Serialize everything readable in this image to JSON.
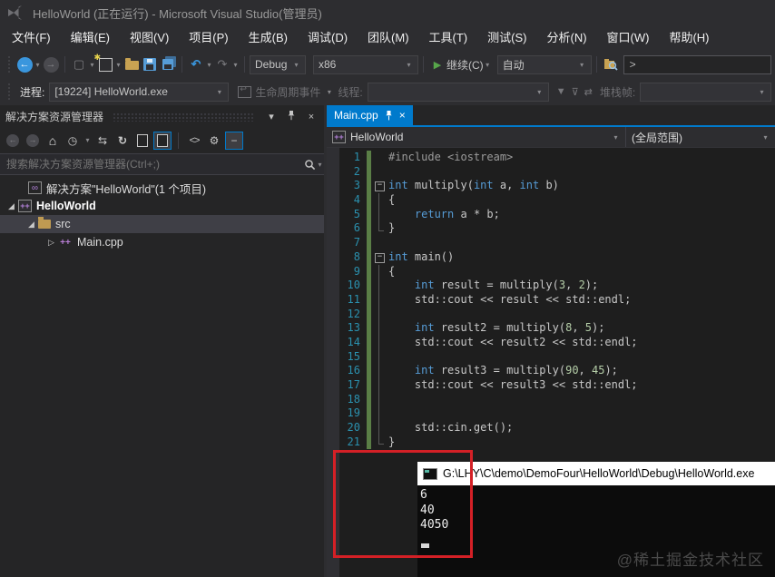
{
  "window": {
    "title": "HelloWorld (正在运行) - Microsoft Visual Studio(管理员)"
  },
  "menu": {
    "items": [
      "文件(F)",
      "编辑(E)",
      "视图(V)",
      "项目(P)",
      "生成(B)",
      "调试(D)",
      "团队(M)",
      "工具(T)",
      "测试(S)",
      "分析(N)",
      "窗口(W)",
      "帮助(H)"
    ]
  },
  "toolbar": {
    "debug_config": "Debug",
    "platform": "x86",
    "continue_label": "继续(C)",
    "auto_label": "自动",
    "prompt": ">"
  },
  "debug_bar": {
    "process_label": "进程:",
    "process_value": "[19224] HelloWorld.exe",
    "lifecycle_label": "生命周期事件",
    "thread_label": "线程:",
    "stack_label": "堆栈帧:"
  },
  "solution_explorer": {
    "title": "解决方案资源管理器",
    "search_placeholder": "搜索解决方案资源管理器(Ctrl+;)",
    "tree": [
      {
        "id": "solution",
        "label": "解决方案\"HelloWorld\"(1 个项目)",
        "icon": "solution",
        "arrow": "none",
        "indent": 16,
        "selected": false,
        "bold": false
      },
      {
        "id": "helloworld",
        "label": "HelloWorld",
        "icon": "project",
        "arrow": "expanded",
        "indent": 5,
        "selected": false,
        "bold": true
      },
      {
        "id": "src",
        "label": "src",
        "icon": "folder",
        "arrow": "expanded",
        "indent": 27,
        "selected": true,
        "bold": false
      },
      {
        "id": "main-cpp",
        "label": "Main.cpp",
        "icon": "cpp",
        "arrow": "collapsed",
        "indent": 49,
        "selected": false,
        "bold": false
      }
    ]
  },
  "editor": {
    "tab": {
      "label": "Main.cpp"
    },
    "nav_left": "HelloWorld",
    "nav_right": "(全局范围)",
    "code": {
      "lines": [
        {
          "n": 1,
          "f": "",
          "s": [
            [
              "pp",
              "#include <iostream>"
            ]
          ]
        },
        {
          "n": 2,
          "f": "",
          "s": []
        },
        {
          "n": 3,
          "f": "box",
          "s": [
            [
              "kw",
              "int"
            ],
            [
              "pl",
              " multiply("
            ],
            [
              "kw",
              "int"
            ],
            [
              "pl",
              " a, "
            ],
            [
              "kw",
              "int"
            ],
            [
              "pl",
              " b)"
            ]
          ]
        },
        {
          "n": 4,
          "f": "bar",
          "s": [
            [
              "pl",
              "{"
            ]
          ]
        },
        {
          "n": 5,
          "f": "bar",
          "s": [
            [
              "pl",
              "    "
            ],
            [
              "kw",
              "return"
            ],
            [
              "pl",
              " a * b;"
            ]
          ]
        },
        {
          "n": 6,
          "f": "end",
          "s": [
            [
              "pl",
              "}"
            ]
          ]
        },
        {
          "n": 7,
          "f": "",
          "s": []
        },
        {
          "n": 8,
          "f": "box",
          "s": [
            [
              "kw",
              "int"
            ],
            [
              "pl",
              " main()"
            ]
          ]
        },
        {
          "n": 9,
          "f": "bar",
          "s": [
            [
              "pl",
              "{"
            ]
          ]
        },
        {
          "n": 10,
          "f": "bar",
          "s": [
            [
              "pl",
              "    "
            ],
            [
              "kw",
              "int"
            ],
            [
              "pl",
              " result = multiply("
            ],
            [
              "num",
              "3"
            ],
            [
              "pl",
              ", "
            ],
            [
              "num",
              "2"
            ],
            [
              "pl",
              ");"
            ]
          ]
        },
        {
          "n": 11,
          "f": "bar",
          "s": [
            [
              "pl",
              "    std::cout << result << std::endl;"
            ]
          ]
        },
        {
          "n": 12,
          "f": "bar",
          "s": []
        },
        {
          "n": 13,
          "f": "bar",
          "s": [
            [
              "pl",
              "    "
            ],
            [
              "kw",
              "int"
            ],
            [
              "pl",
              " result2 = multiply("
            ],
            [
              "num",
              "8"
            ],
            [
              "pl",
              ", "
            ],
            [
              "num",
              "5"
            ],
            [
              "pl",
              ");"
            ]
          ]
        },
        {
          "n": 14,
          "f": "bar",
          "s": [
            [
              "pl",
              "    std::cout << result2 << std::endl;"
            ]
          ]
        },
        {
          "n": 15,
          "f": "bar",
          "s": []
        },
        {
          "n": 16,
          "f": "bar",
          "s": [
            [
              "pl",
              "    "
            ],
            [
              "kw",
              "int"
            ],
            [
              "pl",
              " result3 = multiply("
            ],
            [
              "num",
              "90"
            ],
            [
              "pl",
              ", "
            ],
            [
              "num",
              "45"
            ],
            [
              "pl",
              ");"
            ]
          ]
        },
        {
          "n": 17,
          "f": "bar",
          "s": [
            [
              "pl",
              "    std::cout << result3 << std::endl;"
            ]
          ]
        },
        {
          "n": 18,
          "f": "bar",
          "s": []
        },
        {
          "n": 19,
          "f": "bar",
          "s": []
        },
        {
          "n": 20,
          "f": "bar",
          "s": [
            [
              "pl",
              "    std::cin.get();"
            ]
          ]
        },
        {
          "n": 21,
          "f": "end",
          "s": [
            [
              "pl",
              "}"
            ]
          ]
        }
      ]
    }
  },
  "console": {
    "title": "G:\\LHY\\C\\demo\\DemoFour\\HelloWorld\\Debug\\HelloWorld.exe",
    "lines": [
      "6",
      "40",
      "4050"
    ]
  },
  "watermark": "@稀土掘金技术社区",
  "colors": {
    "accent": "#007ACC",
    "selection": "#3F3F46",
    "keyword": "#569CD6",
    "line_number": "#2B91AF",
    "change_bar": "#5A7E46",
    "annotation_red": "#D42026",
    "console_bg": "#0C0C0C"
  }
}
